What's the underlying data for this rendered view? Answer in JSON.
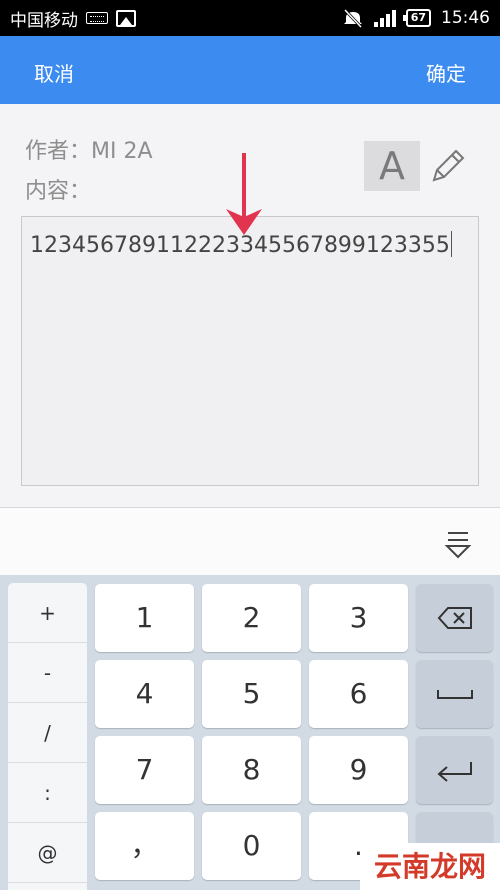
{
  "status_bar": {
    "carrier": "中国移动",
    "battery": "67",
    "time": "15:46"
  },
  "title_bar": {
    "cancel_label": "取消",
    "confirm_label": "确定"
  },
  "form": {
    "author_label": "作者：MI 2A",
    "content_label": "内容：",
    "font_button_label": "A",
    "content_value": "123456789112223345567899123355"
  },
  "keyboard": {
    "symbols": [
      "+",
      "-",
      "/",
      ":",
      "@"
    ],
    "keys": {
      "k1": "1",
      "k2": "2",
      "k3": "3",
      "k4": "4",
      "k5": "5",
      "k6": "6",
      "k7": "7",
      "k8": "8",
      "k9": "9",
      "comma": "，",
      "k0": "0",
      "dot": "."
    },
    "icons": {
      "backspace": "backspace-icon",
      "space": "space-icon",
      "enter": "enter-icon",
      "collapse": "keyboard-collapse-icon"
    }
  },
  "watermark": {
    "text": "云南龙网"
  },
  "colors": {
    "accent": "#3c8bf0",
    "arrow": "#e0344f",
    "watermark": "#d43a2a"
  }
}
